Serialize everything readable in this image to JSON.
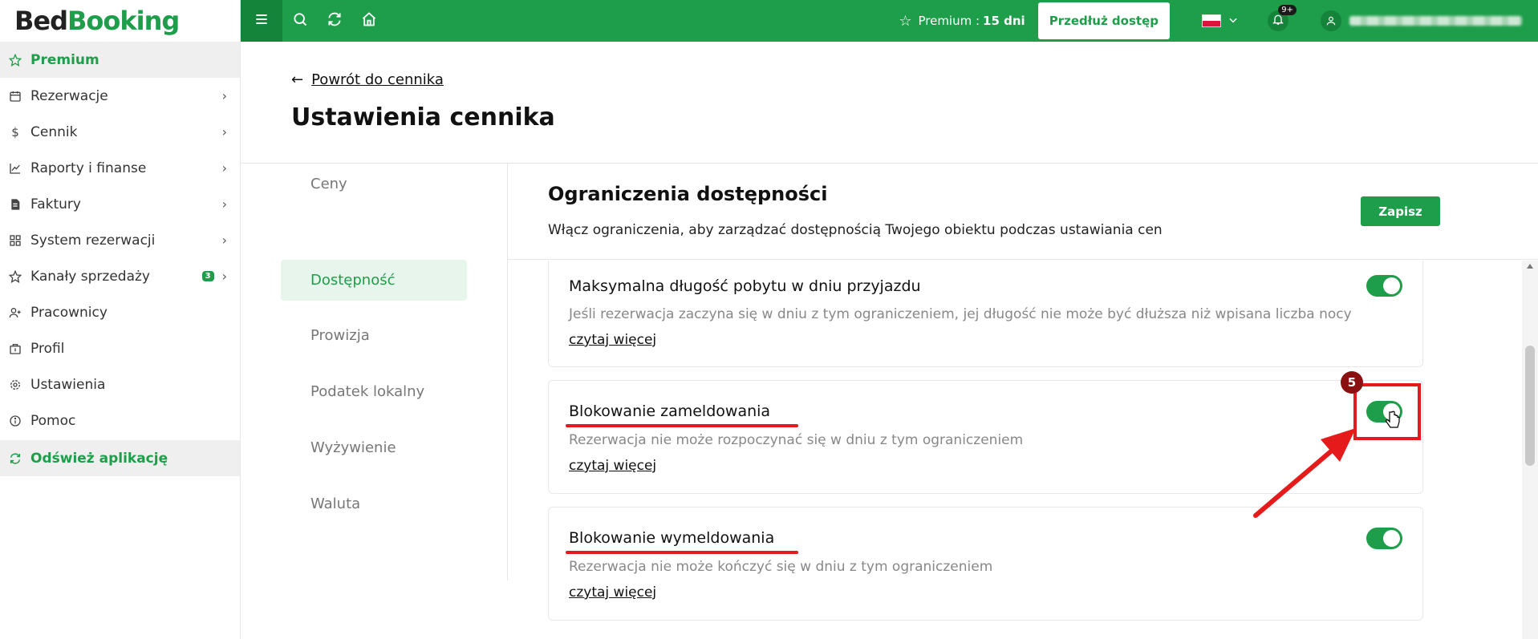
{
  "brand": {
    "part1": "Bed",
    "part2": "Booking"
  },
  "sidebar": {
    "items": [
      {
        "label": "Premium",
        "icon": "star-icon"
      },
      {
        "label": "Rezerwacje",
        "icon": "calendar-icon"
      },
      {
        "label": "Cennik",
        "icon": "dollar-icon"
      },
      {
        "label": "Raporty i finanse",
        "icon": "chart-icon"
      },
      {
        "label": "Faktury",
        "icon": "invoice-icon"
      },
      {
        "label": "System rezerwacji",
        "icon": "grid-icon"
      },
      {
        "label": "Kanały sprzedaży",
        "icon": "star-outline-icon",
        "badge": "3"
      },
      {
        "label": "Pracownicy",
        "icon": "user-plus-icon"
      },
      {
        "label": "Profil",
        "icon": "building-icon"
      },
      {
        "label": "Ustawienia",
        "icon": "gear-icon"
      },
      {
        "label": "Pomoc",
        "icon": "info-icon"
      },
      {
        "label": "Odśwież aplikację",
        "icon": "refresh-icon"
      }
    ]
  },
  "topbar": {
    "premium_label": "Premium :",
    "premium_days": "15 dni",
    "extend_button": "Przedłuż dostęp",
    "notifications_count": "9+",
    "user_name": "[redacted]"
  },
  "header": {
    "back_link": "Powrót do cennika",
    "page_title": "Ustawienia cennika"
  },
  "tabs": [
    "Ceny",
    "Dostępność",
    "Prowizja",
    "Podatek lokalny",
    "Wyżywienie",
    "Waluta"
  ],
  "active_tab": "Dostępność",
  "section": {
    "title": "Ograniczenia dostępności",
    "description": "Włącz ograniczenia, aby zarządzać dostępnością Twojego obiektu podczas ustawiania cen",
    "save_button": "Zapisz"
  },
  "cards": [
    {
      "title": "Maksymalna długość pobytu w dniu przyjazdu",
      "description": "Jeśli rezerwacja zaczyna się w dniu z tym ograniczeniem, jej długość nie może być dłuższa niż wpisana liczba nocy",
      "link": "czytaj więcej",
      "enabled": true
    },
    {
      "title": "Blokowanie zameldowania",
      "description": "Rezerwacja nie może rozpoczynać się w dniu z tym ograniczeniem",
      "link": "czytaj więcej",
      "enabled": true
    },
    {
      "title": "Blokowanie wymeldowania",
      "description": "Rezerwacja nie może kończyć się w dniu z tym ograniczeniem",
      "link": "czytaj więcej",
      "enabled": true
    }
  ],
  "annotation": {
    "step": "5"
  },
  "colors": {
    "primary": "#1e9e4a",
    "annotation": "#e51b1b"
  }
}
